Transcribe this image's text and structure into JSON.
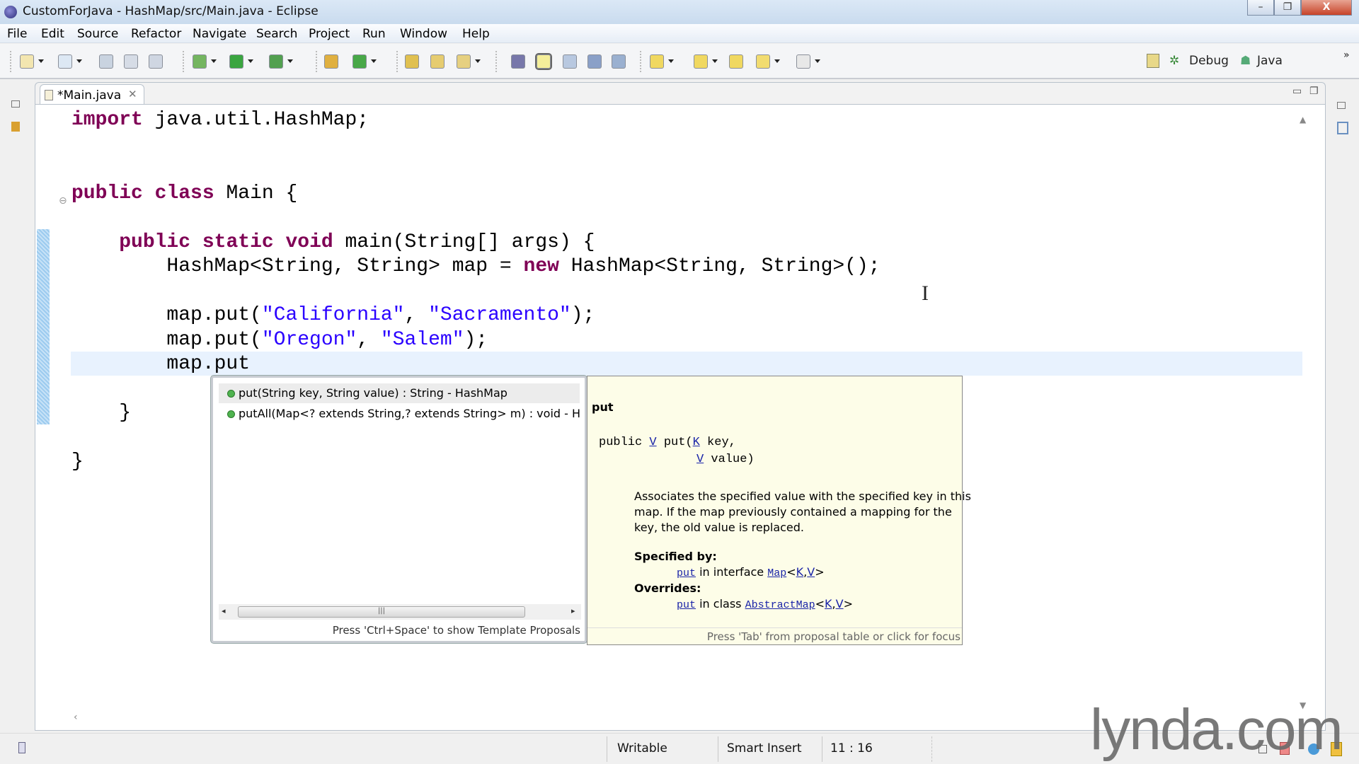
{
  "window": {
    "title": "CustomForJava - HashMap/src/Main.java - Eclipse",
    "minimize": "–",
    "restore": "❐",
    "close": "X"
  },
  "menu": [
    "File",
    "Edit",
    "Source",
    "Refactor",
    "Navigate",
    "Search",
    "Project",
    "Run",
    "Window",
    "Help"
  ],
  "toolbar": {
    "icons": [
      "new-wizard-icon",
      "new-java-project-icon",
      "save-icon",
      "save-all-icon",
      "print-icon",
      "debug-icon",
      "run-icon",
      "external-tools-icon",
      "new-java-package-icon",
      "new-java-class-icon",
      "open-type-icon",
      "open-resource-icon",
      "search-icon",
      "toggle-breadcrumb-icon",
      "mark-occurrences-icon",
      "block-selection-icon",
      "show-whitespace-icon",
      "show-source-icon",
      "next-annotation-icon",
      "previous-annotation-icon",
      "last-edit-location-icon",
      "back-icon",
      "forward-icon"
    ],
    "perspectives": {
      "debug": "Debug",
      "java": "Java",
      "more": "»"
    }
  },
  "editor": {
    "tab_label": "*Main.java",
    "lines": [
      [
        {
          "t": "import",
          "c": "kw"
        },
        {
          "t": " java.util.HashMap;"
        }
      ],
      [],
      [],
      [
        {
          "t": "public",
          "c": "kw"
        },
        {
          "t": " "
        },
        {
          "t": "class",
          "c": "kw"
        },
        {
          "t": " Main {"
        }
      ],
      [],
      [
        {
          "t": "    "
        },
        {
          "t": "public",
          "c": "kw"
        },
        {
          "t": " "
        },
        {
          "t": "static",
          "c": "kw"
        },
        {
          "t": " "
        },
        {
          "t": "void",
          "c": "kw"
        },
        {
          "t": " main(String[] args) {"
        }
      ],
      [
        {
          "t": "        HashMap<String, String> map = "
        },
        {
          "t": "new",
          "c": "kw"
        },
        {
          "t": " HashMap<String, String>();"
        }
      ],
      [],
      [
        {
          "t": "        map.put("
        },
        {
          "t": "\"California\"",
          "c": "str"
        },
        {
          "t": ", "
        },
        {
          "t": "\"Sacramento\"",
          "c": "str"
        },
        {
          "t": ");"
        }
      ],
      [
        {
          "t": "        map.put("
        },
        {
          "t": "\"Oregon\"",
          "c": "str"
        },
        {
          "t": ", "
        },
        {
          "t": "\"Salem\"",
          "c": "str"
        },
        {
          "t": ");"
        }
      ],
      [
        {
          "t": "        map.put"
        }
      ],
      [],
      [
        {
          "t": "    }"
        }
      ],
      [],
      [
        {
          "t": "}"
        }
      ]
    ],
    "current_line": 10
  },
  "proposals": {
    "items": [
      {
        "label": "put(String key, String value) : String - HashMap",
        "selected": true
      },
      {
        "label": "putAll(Map<? extends String,? extends String> m) : void - Ha",
        "selected": false
      }
    ],
    "footer": "Press 'Ctrl+Space' to show Template Proposals"
  },
  "javadoc": {
    "name": "put",
    "sig_public": "public ",
    "sig_v": "V",
    "sig_put": " put(",
    "sig_k": "K",
    "sig_key": " key,",
    "sig_v2": "V",
    "sig_value": " value)",
    "description": [
      "Associates the specified value with the specified key in this",
      "map. If the map previously contained a mapping for the",
      "key, the old value is replaced."
    ],
    "specified_by": "Specified by:",
    "spec_put": "put",
    "spec_in": " in interface ",
    "spec_map": "Map",
    "spec_lt": "<",
    "spec_k": "K",
    "spec_comma": ",",
    "spec_v": "V",
    "spec_gt": ">",
    "overrides": "Overrides:",
    "ov_put": "put",
    "ov_in": " in class ",
    "ov_class": "AbstractMap",
    "footer": "Press 'Tab' from proposal table or click for focus"
  },
  "status": {
    "writable": "Writable",
    "insert_mode": "Smart Insert",
    "position": "11 : 16"
  },
  "watermark": "lynda.com",
  "colors": {
    "keyword": "#7f0055",
    "string": "#2a00ff",
    "current_line": "#e8f2fe",
    "javadoc_bg": "#fdfde8"
  }
}
